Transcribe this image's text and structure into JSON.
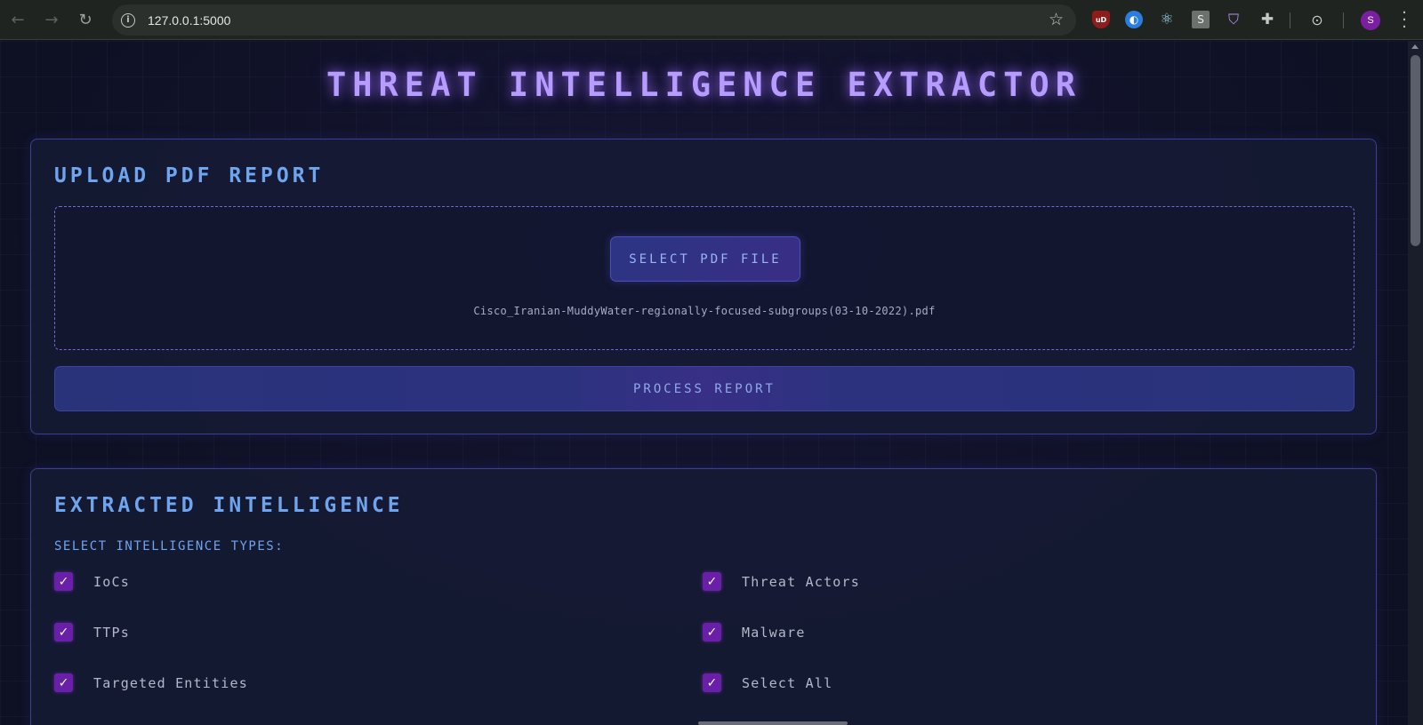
{
  "browser": {
    "url": "127.0.0.1:5000",
    "back_icon": "arrow-left",
    "forward_icon": "arrow-right",
    "reload_icon": "reload",
    "extensions": [
      "ublock-origin",
      "blue-circle-extension",
      "react-devtools",
      "s-extension",
      "shield-extension",
      "puzzle-extensions",
      "screenshot-lens"
    ],
    "ublock_text": "uD",
    "s_ext_text": "S",
    "avatar_initial": "S"
  },
  "app": {
    "title": "THREAT INTELLIGENCE EXTRACTOR",
    "accent_color": "#b79cff"
  },
  "upload": {
    "title": "UPLOAD PDF REPORT",
    "select_button": "SELECT PDF FILE",
    "selected_file": "Cisco_Iranian-MuddyWater-regionally-focused-subgroups(03-10-2022).pdf",
    "process_button": "PROCESS REPORT"
  },
  "extract": {
    "title": "EXTRACTED INTELLIGENCE",
    "types_label": "SELECT INTELLIGENCE TYPES:",
    "options": [
      {
        "label": "IoCs",
        "checked": true
      },
      {
        "label": "Threat Actors",
        "checked": true
      },
      {
        "label": "TTPs",
        "checked": true
      },
      {
        "label": "Malware",
        "checked": true
      },
      {
        "label": "Targeted Entities",
        "checked": true
      },
      {
        "label": "Select All",
        "checked": true
      }
    ]
  }
}
